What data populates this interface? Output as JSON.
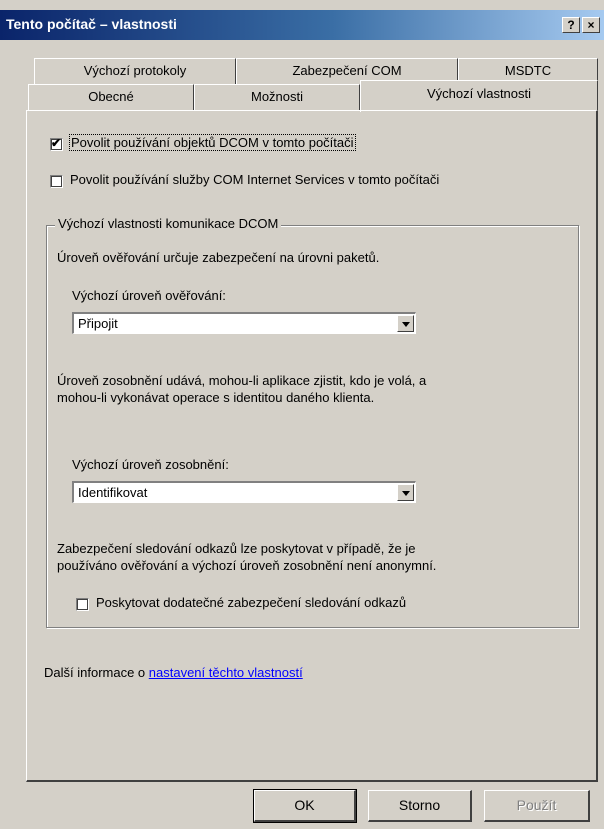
{
  "window": {
    "title": "Tento počítač – vlastnosti",
    "help_glyph": "?",
    "close_glyph": "×"
  },
  "tabs": {
    "row_back": [
      "Výchozí protokoly",
      "Zabezpečení COM",
      "MSDTC"
    ],
    "row_front": [
      "Obecné",
      "Možnosti",
      "Výchozí vlastnosti"
    ],
    "active": "Výchozí vlastnosti"
  },
  "options": {
    "enable_dcom": {
      "label": "Povolit používání objektů DCOM v tomto počítači",
      "checked": true,
      "check_glyph": "✔"
    },
    "enable_cis": {
      "label": "Povolit používání služby COM Internet Services v tomto počítači",
      "checked": false
    }
  },
  "group": {
    "title": "Výchozí vlastnosti komunikace DCOM",
    "auth_desc": "Úroveň ověřování určuje zabezpečení na úrovni paketů.",
    "auth_label": "Výchozí úroveň ověřování:",
    "auth_value": "Připojit",
    "imp_desc_1": "Úroveň zosobnění udává, mohou-li aplikace zjistit, kdo je volá, a",
    "imp_desc_2": "mohou-li vykonávat operace s identitou daného klienta.",
    "imp_label": "Výchozí úroveň zosobnění:",
    "imp_value": "Identifikovat",
    "track_desc_1": "Zabezpečení sledování odkazů lze poskytovat v případě, že je",
    "track_desc_2": "používáno ověřování a výchozí úroveň zosobnění není anonymní.",
    "track_checkbox": {
      "label": "Poskytovat dodatečné zabezpečení sledování odkazů",
      "checked": false
    }
  },
  "more_info": {
    "prefix": "Další informace o ",
    "link": "nastavení těchto vlastností"
  },
  "buttons": {
    "ok": "OK",
    "cancel": "Storno",
    "apply": "Použít"
  }
}
